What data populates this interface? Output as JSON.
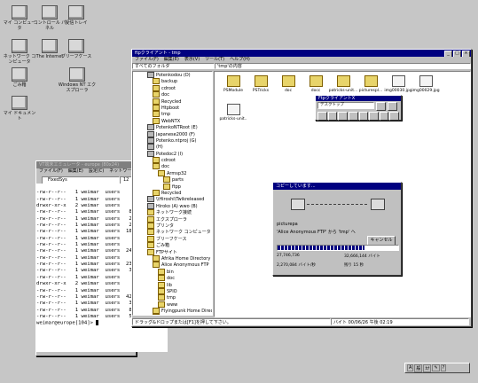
{
  "desktop": {
    "icons": [
      {
        "label": "マイ コンピュータ",
        "icon": "my-computer-icon"
      },
      {
        "label": "コントロール パネル",
        "icon": "control-panel-icon"
      },
      {
        "label": "受信トレイ",
        "icon": "inbox-icon"
      },
      {
        "label": "ネットワーク コンピュータ",
        "icon": "network-icon"
      },
      {
        "label": "The Internet",
        "icon": "internet-icon"
      },
      {
        "label": "ブリーフケース",
        "icon": "briefcase-icon"
      },
      {
        "label": "ごみ箱",
        "icon": "recycle-bin-icon"
      },
      {
        "label": "Windows NT エクスプローラ",
        "icon": "explorer-icon"
      },
      {
        "label": "マイ ドキュメント",
        "icon": "documents-icon"
      }
    ]
  },
  "explorer": {
    "title": "ftpクライアント - tmp",
    "menu": [
      "ファイル(F)",
      "編集(E)",
      "表示(V)",
      "ツール(T)",
      "ヘルプ(H)"
    ],
    "left_header": "すべてのフォルダ",
    "right_header": "'tmp'の内容",
    "tree": [
      "Potenkodou (D)",
      "backup",
      "cdroot",
      "doc",
      "Recycled",
      "Htpboot",
      "tmp",
      "WebNTX",
      "PotenkoNTRoot (E)",
      "Japanese2000 (F)",
      "Potenko.ntproj (G)",
      "(H)",
      "Potedoc2 (I)",
      "cdroot",
      "doc",
      "Armsp32",
      "parts",
      "ftpp",
      "Recycled",
      "\\\\Hiroshi\\Twikreleased",
      "Hiroko (A) wwo (B)",
      "ネットワーク接続",
      "エクスプローラ",
      "プリンタ",
      "ネットワーク コンピュータ",
      "ブリーフケース",
      "ごみ箱",
      "FTPサイト",
      "Afrika Home Directory",
      "Alice Anonymous FTP",
      "bin",
      "doc",
      "lib",
      "SPIO",
      "tmp",
      "www",
      "Flyingpunk Home Directo",
      "punTMNaAfrika"
    ],
    "files": [
      {
        "name": "PSModule",
        "type": "folder"
      },
      {
        "name": "PSTricks",
        "type": "folder"
      },
      {
        "name": "doc",
        "type": "folder"
      },
      {
        "name": "docc",
        "type": "folder"
      },
      {
        "name": "patricks-unit...",
        "type": "folder"
      },
      {
        "name": "picturespl...",
        "type": "folder"
      },
      {
        "name": "img00030.jpg",
        "type": "doc"
      },
      {
        "name": "img00029.jpg",
        "type": "doc"
      },
      {
        "name": "patricks-unit..",
        "type": "doc"
      }
    ],
    "status_left": "ドラッグ&ドロップまたは[F1]を押して下さい。",
    "status_right": "バイト    00/06/26  午後 02:19"
  },
  "ftp_toolbar": {
    "title": "FtpクライアントX",
    "address": "デスクトップ"
  },
  "copy_dialog": {
    "title": "コピーしています...",
    "file": "picturepa",
    "source": "'Alice Anonymous FTP' から 'tmp' へ",
    "cancel_label": "キャンセル",
    "bytes_done": "27,746,736",
    "bytes_total": "32,666,144 バイト",
    "elapsed": "2,270,084 バイト/秒",
    "speed": "残り 15 秒",
    "progress": 0.72
  },
  "terminal": {
    "title": "VT端末エミュレータ - europe (80x24)",
    "menu": [
      "ファイル(F)",
      "編集(E)",
      "設定(C)",
      "ネットワーク(N)",
      "ヘ"
    ],
    "font_select": "FixedSys",
    "size_select": "12",
    "lines": [
      "-rw-r--r--   1 weimar  users    .",
      "-rw-r--r--   1 weimar  users    .",
      "drwxr-xr-x   2 weimar  users    .",
      "-rw-r--r--   1 weimar  users   8",
      "-rw-r--r--   1 weimar  users   2",
      "-rw-r--r--   1 weimar  users   2",
      "-rw-r--r--   1 weimar  users  18",
      "-rw-r--r--   1 weimar  users    .",
      "-rw-r--r--   1 weimar  users    .",
      "-rw-r--r--   1 weimar  users  24",
      "-rw-r--r--   1 weimar  users    .",
      "-rw-r--r--   1 weimar  users  23",
      "-rw-r--r--   1 weimar  users   3",
      "-rw-r--r--   1 weimar  users    .",
      "drwxr-xr-x   2 weimar  users    .",
      "-rw-r--r--   1 weimar  users    .",
      "-rw-r--r--   1 weimar  users  4298 Oct  5  1999 numbers.c",
      "-rw-r--r--   1 weimar  users   334 Oct  5  1999 numbers.h",
      "-rw-r--r--   1 weimar  users   896 Oct  4  1999 potsmath.cc",
      "-rw-r--r--   1 weimar  users   553 Jul 29 14:01 vsscanftest.cc",
      "weimar@europe[104]> "
    ]
  },
  "tray": {
    "items": [
      "A",
      "般",
      "ｶﾅ",
      "✎",
      "?"
    ]
  }
}
